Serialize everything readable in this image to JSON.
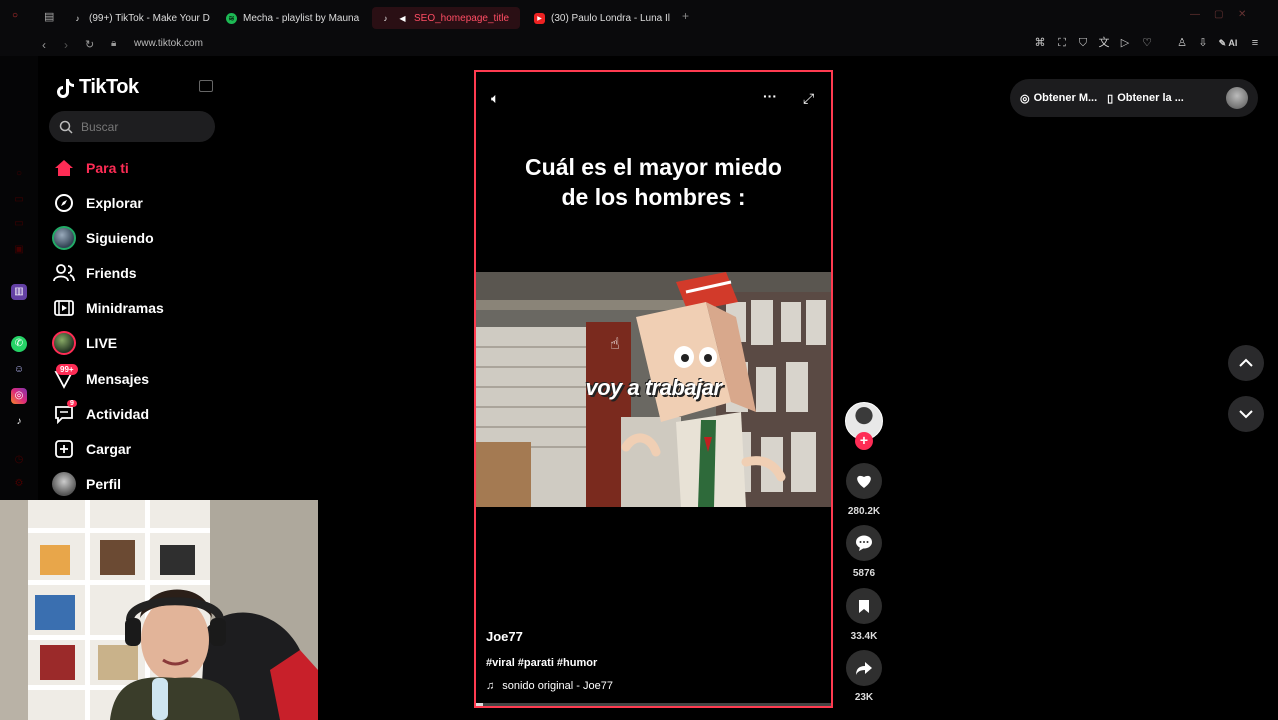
{
  "browser": {
    "tabs": [
      {
        "label": "(99+) TikTok - Make Your D",
        "active": false
      },
      {
        "label": "Mecha - playlist by Mauna",
        "active": false
      },
      {
        "label": "SEO_homepage_title",
        "active": true
      },
      {
        "label": "(30) Paulo Londra - Luna Il",
        "active": false
      }
    ],
    "url": "www.tiktok.com",
    "ai_label": "AI"
  },
  "sidebar": {
    "logo_text": "TikTok",
    "search_placeholder": "Buscar",
    "items": [
      {
        "label": "Para ti",
        "icon": "home-icon",
        "active": true
      },
      {
        "label": "Explorar",
        "icon": "compass-icon"
      },
      {
        "label": "Siguiendo",
        "icon": "following-avatar-icon"
      },
      {
        "label": "Friends",
        "icon": "friends-icon"
      },
      {
        "label": "Minidramas",
        "icon": "film-icon"
      },
      {
        "label": "LIVE",
        "icon": "live-avatar-icon"
      },
      {
        "label": "Mensajes",
        "icon": "inbox-icon",
        "badge": "99+"
      },
      {
        "label": "Actividad",
        "icon": "activity-icon",
        "badge": "9"
      },
      {
        "label": "Cargar",
        "icon": "upload-icon"
      },
      {
        "label": "Perfil",
        "icon": "profile-icon"
      }
    ]
  },
  "video": {
    "caption_line1": "Cuál es el mayor miedo",
    "caption_line2": "de los hombres :",
    "scene_text": "voy a trabajar",
    "author": "Joe77",
    "hashtags": "#viral #parati #humor",
    "sound": "sonido original - Joe77",
    "progress": 0.02
  },
  "actions": {
    "likes": "280.2K",
    "comments": "5876",
    "saves": "33.4K",
    "shares": "23K"
  },
  "top_right": {
    "get_coins": "Obtener M...",
    "get_app": "Obtener la ..."
  },
  "colors": {
    "accent": "#fe2c55",
    "video_border": "#ff3b50",
    "background": "#000000"
  }
}
